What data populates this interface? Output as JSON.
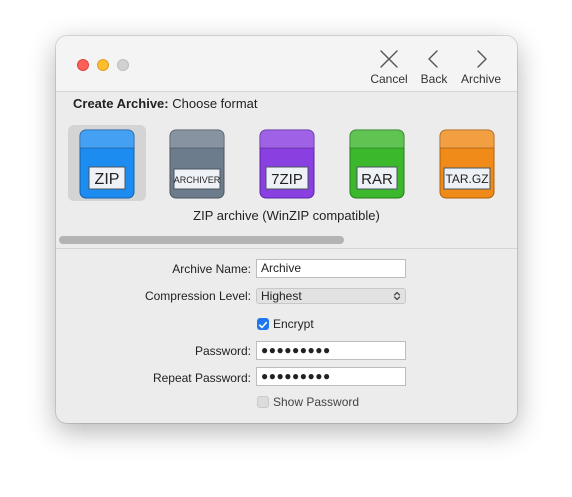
{
  "toolbar": {
    "cancel_label": "Cancel",
    "back_label": "Back",
    "archive_label": "Archive"
  },
  "heading": {
    "bold": "Create Archive:",
    "rest": "Choose format"
  },
  "formats": [
    {
      "label": "ZIP",
      "color": "#1c8cf0",
      "selected": true
    },
    {
      "label": "ARCHIVER",
      "color": "#6d7c8c",
      "selected": false
    },
    {
      "label": "7ZIP",
      "color": "#8a3fe0",
      "selected": false
    },
    {
      "label": "RAR",
      "color": "#3cb82c",
      "selected": false
    },
    {
      "label": "TAR.GZ",
      "color": "#f08a18",
      "selected": false
    }
  ],
  "format_description": "ZIP archive (WinZIP compatible)",
  "form": {
    "archive_name_label": "Archive Name:",
    "archive_name_value": "Archive",
    "compression_label": "Compression Level:",
    "compression_value": "Highest",
    "encrypt_label": "Encrypt",
    "encrypt_checked": true,
    "password_label": "Password:",
    "password_value": "●●●●●●●●●",
    "repeat_password_label": "Repeat Password:",
    "repeat_password_value": "●●●●●●●●●",
    "show_password_label": "Show Password",
    "show_password_checked": false
  }
}
